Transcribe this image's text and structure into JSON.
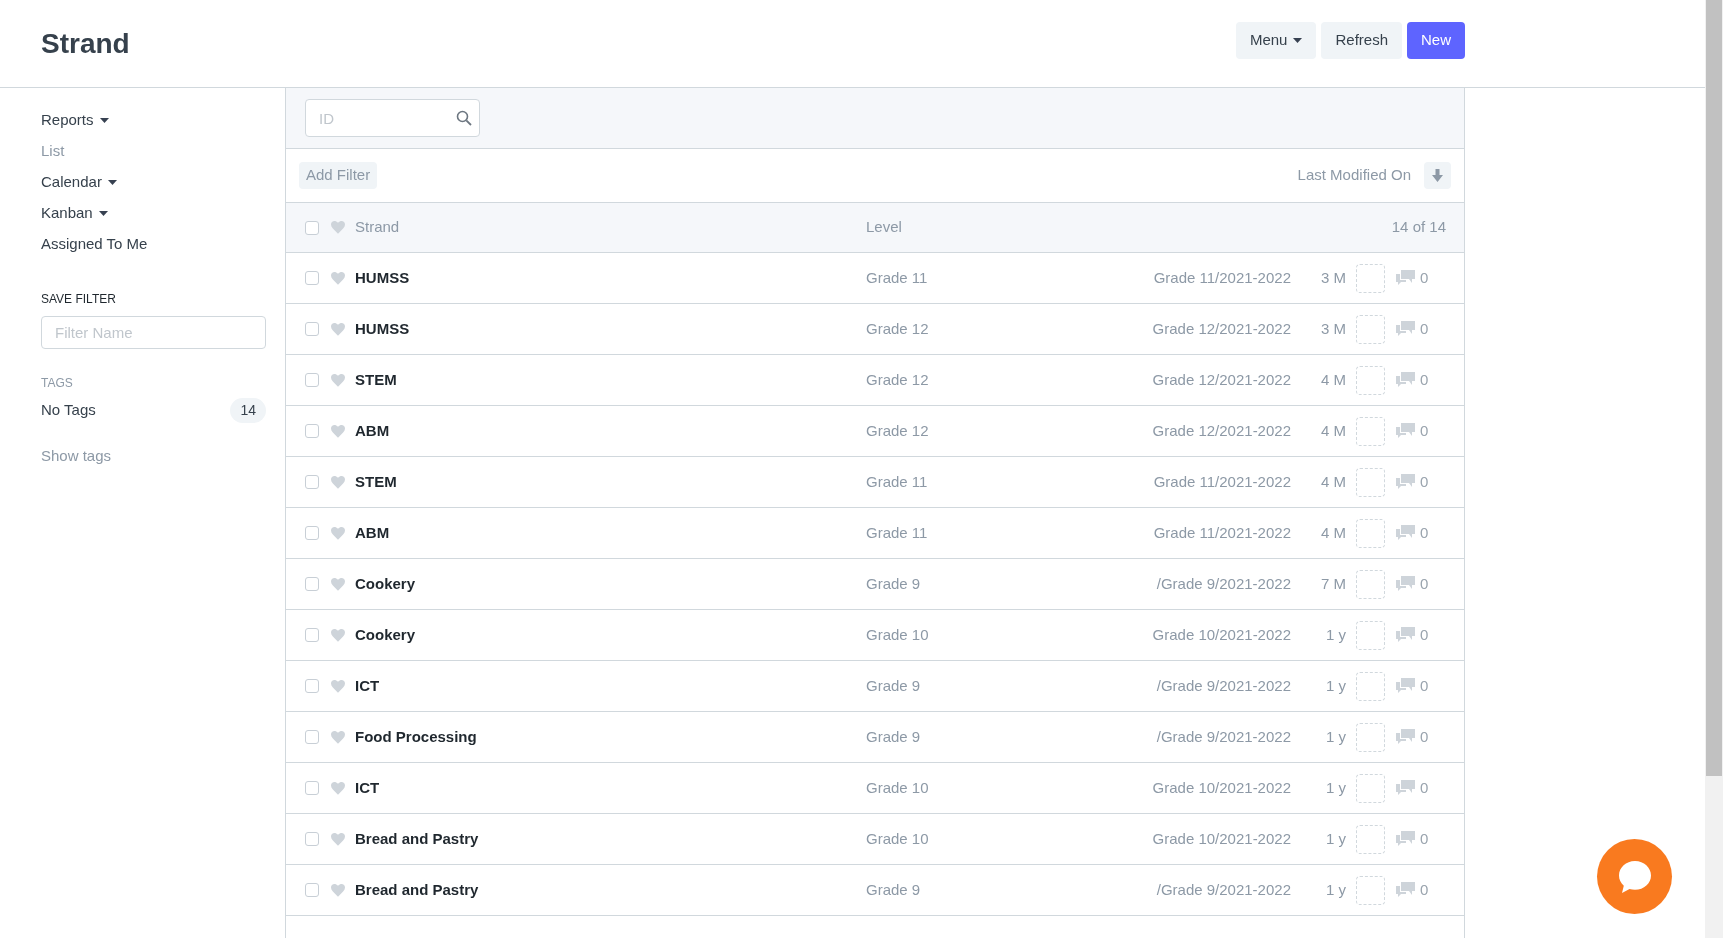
{
  "page": {
    "title": "Strand"
  },
  "actions": [
    {
      "label": "Menu",
      "kind": "dropdown"
    },
    {
      "label": "Refresh",
      "kind": "plain"
    },
    {
      "label": "New",
      "kind": "primary"
    }
  ],
  "sidebar": {
    "items": [
      {
        "label": "Reports",
        "dropdown": true,
        "selected": false
      },
      {
        "label": "List",
        "dropdown": false,
        "selected": true
      },
      {
        "label": "Calendar",
        "dropdown": true,
        "selected": false
      },
      {
        "label": "Kanban",
        "dropdown": true,
        "selected": false
      },
      {
        "label": "Assigned To Me",
        "dropdown": false,
        "selected": false
      }
    ],
    "save_filter": {
      "heading": "SAVE FILTER",
      "placeholder": "Filter Name"
    },
    "tags": {
      "heading": "TAGS",
      "items": [
        {
          "label": "No Tags",
          "count": "14"
        }
      ],
      "show_link": "Show tags"
    }
  },
  "search": {
    "placeholder": "ID"
  },
  "filter_bar": {
    "add_filter": "Add Filter",
    "sort_label": "Last Modified On"
  },
  "table": {
    "columns": [
      "Strand",
      "Level"
    ],
    "count": "14 of 14",
    "select_all": {
      "checked": false
    },
    "rows": [
      {
        "name": "HUMSS",
        "level": "Grade 11",
        "subtitle": "Grade 11/2021-2022",
        "modified": "3 M",
        "comments": "0",
        "checked": false,
        "liked": false
      },
      {
        "name": "HUMSS",
        "level": "Grade 12",
        "subtitle": "Grade 12/2021-2022",
        "modified": "3 M",
        "comments": "0",
        "checked": false,
        "liked": false
      },
      {
        "name": "STEM",
        "level": "Grade 12",
        "subtitle": "Grade 12/2021-2022",
        "modified": "4 M",
        "comments": "0",
        "checked": false,
        "liked": false
      },
      {
        "name": "ABM",
        "level": "Grade 12",
        "subtitle": "Grade 12/2021-2022",
        "modified": "4 M",
        "comments": "0",
        "checked": false,
        "liked": false
      },
      {
        "name": "STEM",
        "level": "Grade 11",
        "subtitle": "Grade 11/2021-2022",
        "modified": "4 M",
        "comments": "0",
        "checked": false,
        "liked": false
      },
      {
        "name": "ABM",
        "level": "Grade 11",
        "subtitle": "Grade 11/2021-2022",
        "modified": "4 M",
        "comments": "0",
        "checked": false,
        "liked": false
      },
      {
        "name": "Cookery",
        "level": "Grade 9",
        "subtitle": "/Grade 9/2021-2022",
        "modified": "7 M",
        "comments": "0",
        "checked": false,
        "liked": false
      },
      {
        "name": "Cookery",
        "level": "Grade 10",
        "subtitle": "Grade 10/2021-2022",
        "modified": "1 y",
        "comments": "0",
        "checked": false,
        "liked": false
      },
      {
        "name": "ICT",
        "level": "Grade 9",
        "subtitle": "/Grade 9/2021-2022",
        "modified": "1 y",
        "comments": "0",
        "checked": false,
        "liked": false
      },
      {
        "name": "Food Processing",
        "level": "Grade 9",
        "subtitle": "/Grade 9/2021-2022",
        "modified": "1 y",
        "comments": "0",
        "checked": false,
        "liked": false
      },
      {
        "name": "ICT",
        "level": "Grade 10",
        "subtitle": "Grade 10/2021-2022",
        "modified": "1 y",
        "comments": "0",
        "checked": false,
        "liked": false
      },
      {
        "name": "Bread and Pastry",
        "level": "Grade 10",
        "subtitle": "Grade 10/2021-2022",
        "modified": "1 y",
        "comments": "0",
        "checked": false,
        "liked": false
      },
      {
        "name": "Bread and Pastry",
        "level": "Grade 9",
        "subtitle": "/Grade 9/2021-2022",
        "modified": "1 y",
        "comments": "0",
        "checked": false,
        "liked": false
      }
    ]
  }
}
